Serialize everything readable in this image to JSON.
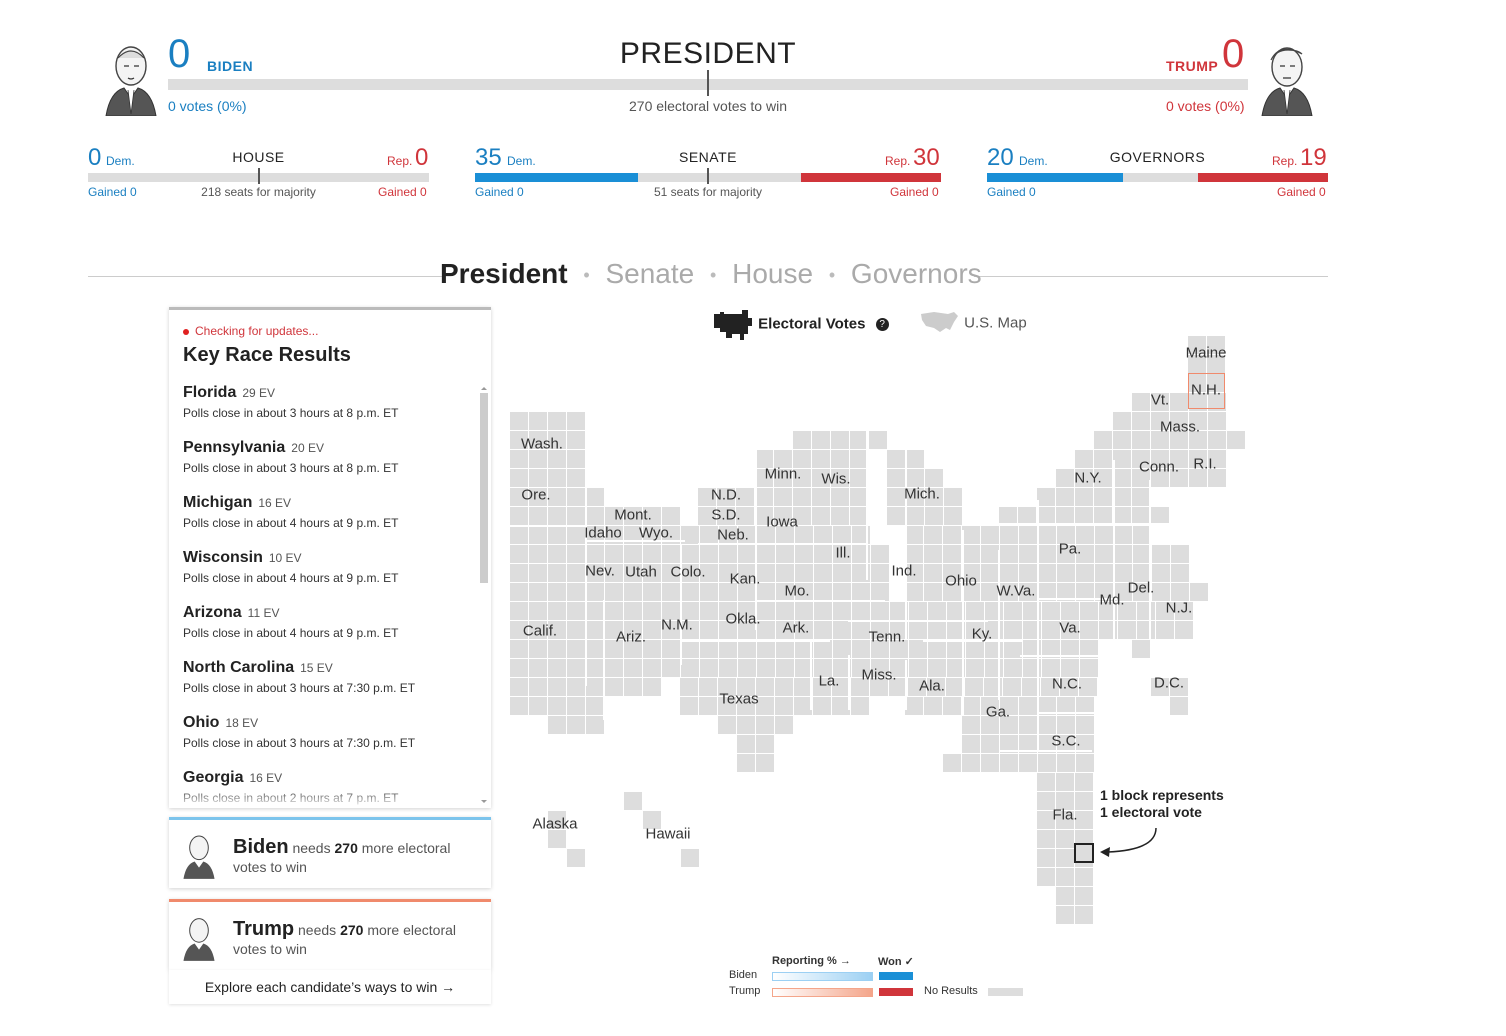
{
  "president": {
    "title": "PRESIDENT",
    "to_win": "270 electoral votes to win",
    "biden": {
      "name": "BIDEN",
      "ev": "0",
      "votes": "0 votes (0%)"
    },
    "trump": {
      "name": "TRUMP",
      "ev": "0",
      "votes": "0 votes (0%)"
    }
  },
  "house": {
    "title": "HOUSE",
    "dem": "0",
    "rep": "0",
    "dem_lbl": "Dem.",
    "rep_lbl": "Rep.",
    "dem_gained": "Gained 0",
    "rep_gained": "Gained 0",
    "majority": "218 seats for majority",
    "dem_share": 0,
    "rep_share": 0
  },
  "senate": {
    "title": "SENATE",
    "dem": "35",
    "rep": "30",
    "dem_lbl": "Dem.",
    "rep_lbl": "Rep.",
    "dem_gained": "Gained 0",
    "rep_gained": "Gained 0",
    "majority": "51 seats for majority",
    "dem_share": 0.35,
    "rep_share": 0.3
  },
  "governors": {
    "title": "GOVERNORS",
    "dem": "20",
    "rep": "19",
    "dem_lbl": "Dem.",
    "rep_lbl": "Rep.",
    "dem_gained": "Gained 0",
    "rep_gained": "Gained 0",
    "dem_share": 0.4,
    "rep_share": 0.38
  },
  "nav": {
    "president": "President",
    "senate": "Senate",
    "house": "House",
    "governors": "Governors",
    "sep": "•"
  },
  "key_races": {
    "status": "Checking for updates...",
    "title": "Key Race Results",
    "races": [
      {
        "name": "Florida",
        "ev": "29 EV",
        "poll": "Polls close in about 3 hours at 8 p.m. ET"
      },
      {
        "name": "Pennsylvania",
        "ev": "20 EV",
        "poll": "Polls close in about 3 hours at 8 p.m. ET"
      },
      {
        "name": "Michigan",
        "ev": "16 EV",
        "poll": "Polls close in about 4 hours at 9 p.m. ET"
      },
      {
        "name": "Wisconsin",
        "ev": "10 EV",
        "poll": "Polls close in about 4 hours at 9 p.m. ET"
      },
      {
        "name": "Arizona",
        "ev": "11 EV",
        "poll": "Polls close in about 4 hours at 9 p.m. ET"
      },
      {
        "name": "North Carolina",
        "ev": "15 EV",
        "poll": "Polls close in about 3 hours at 7:30 p.m. ET"
      },
      {
        "name": "Ohio",
        "ev": "18 EV",
        "poll": "Polls close in about 3 hours at 7:30 p.m. ET"
      },
      {
        "name": "Georgia",
        "ev": "16 EV",
        "poll": "Polls close in about 2 hours at 7 p.m. ET"
      }
    ]
  },
  "needs": {
    "biden": {
      "name": "Biden",
      "pre": "needs",
      "num": "270",
      "post": "more electoral votes to win"
    },
    "trump": {
      "name": "Trump",
      "pre": "needs",
      "num": "270",
      "post": "more electoral votes to win"
    },
    "explore": "Explore each candidate’s ways to win →"
  },
  "map_toggle": {
    "ev": "Electoral Votes",
    "help": "?",
    "us": "U.S. Map"
  },
  "map_note": {
    "line1": "1 block represents",
    "line2": "1 electoral vote"
  },
  "states": [
    {
      "n": "Maine"
    },
    {
      "n": "N.H."
    },
    {
      "n": "Vt."
    },
    {
      "n": "Mass."
    },
    {
      "n": "R.I."
    },
    {
      "n": "Conn."
    },
    {
      "n": "N.Y."
    },
    {
      "n": "Wash."
    },
    {
      "n": "Ore."
    },
    {
      "n": "Mont."
    },
    {
      "n": "Idaho"
    },
    {
      "n": "Wyo."
    },
    {
      "n": "N.D."
    },
    {
      "n": "S.D."
    },
    {
      "n": "Neb."
    },
    {
      "n": "Minn."
    },
    {
      "n": "Wis."
    },
    {
      "n": "Mich."
    },
    {
      "n": "Iowa"
    },
    {
      "n": "Ill."
    },
    {
      "n": "Ind."
    },
    {
      "n": "Ohio"
    },
    {
      "n": "Pa."
    },
    {
      "n": "N.J."
    },
    {
      "n": "Del."
    },
    {
      "n": "Md."
    },
    {
      "n": "D.C."
    },
    {
      "n": "W.Va."
    },
    {
      "n": "Va."
    },
    {
      "n": "Nev."
    },
    {
      "n": "Utah"
    },
    {
      "n": "Colo."
    },
    {
      "n": "Kan."
    },
    {
      "n": "Mo."
    },
    {
      "n": "Ky."
    },
    {
      "n": "Calif."
    },
    {
      "n": "Ariz."
    },
    {
      "n": "N.M."
    },
    {
      "n": "Okla."
    },
    {
      "n": "Ark."
    },
    {
      "n": "Tenn."
    },
    {
      "n": "N.C."
    },
    {
      "n": "Texas"
    },
    {
      "n": "La."
    },
    {
      "n": "Miss."
    },
    {
      "n": "Ala."
    },
    {
      "n": "Ga."
    },
    {
      "n": "S.C."
    },
    {
      "n": "Fla."
    },
    {
      "n": "Alaska"
    },
    {
      "n": "Hawaii"
    }
  ],
  "legend": {
    "reporting": "Reporting % →",
    "won": "Won ✓",
    "biden": "Biden",
    "trump": "Trump",
    "no_results": "No Results",
    "colors": {
      "biden": "#1a8fd6",
      "trump": "#d0353b",
      "none": "#dddddd"
    }
  }
}
